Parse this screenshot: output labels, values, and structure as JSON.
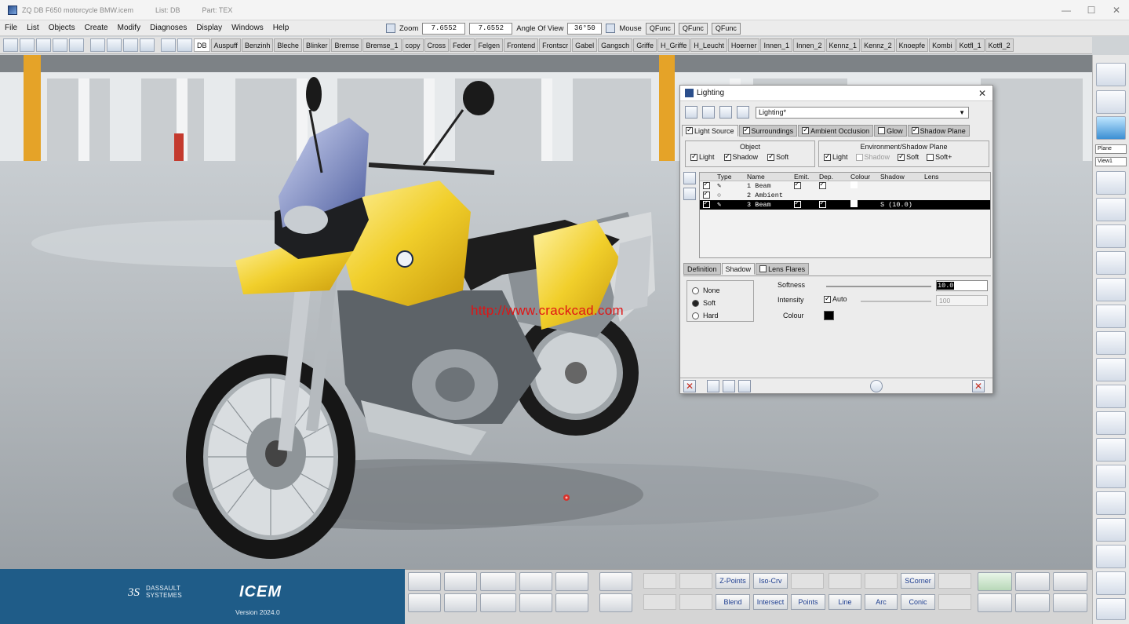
{
  "window": {
    "title_segments": [
      "ZQ DB F650 motorcycle BMW.icem",
      "List: DB",
      "Part: TEX"
    ]
  },
  "menu": [
    "File",
    "List",
    "Objects",
    "Create",
    "Modify",
    "Diagnoses",
    "Display",
    "Windows",
    "Help"
  ],
  "view_controls": {
    "zoom_label": "Zoom",
    "zoom_value_1": "7.6552",
    "zoom_value_2": "7.6552",
    "angle_label": "Angle Of View",
    "angle_value": "36°50",
    "mouse_label": "Mouse",
    "qfunc_buttons": [
      "QFunc",
      "QFunc",
      "QFunc"
    ]
  },
  "parts": [
    "DB",
    "Auspuff",
    "Benzinh",
    "Bleche",
    "Blinker",
    "Bremse",
    "Bremse_1",
    "copy",
    "Cross",
    "Feder",
    "Felgen",
    "Frontend",
    "Frontscr",
    "Gabel",
    "Gangsch",
    "Griffe",
    "H_Griffe",
    "H_Leucht",
    "Hoerner",
    "Innen_1",
    "Innen_2",
    "Kennz_1",
    "Kennz_2",
    "Knoepfe",
    "Kombi",
    "Kotfl_1",
    "Kotfl_2"
  ],
  "watermark": "http://www.crackcad.com",
  "lighting": {
    "title": "Lighting",
    "preset": "Lighting*",
    "tabs": [
      {
        "label": "Light Source",
        "checked": true
      },
      {
        "label": "Surroundings",
        "checked": true
      },
      {
        "label": "Ambient Occlusion",
        "checked": true
      },
      {
        "label": "Glow",
        "checked": false
      },
      {
        "label": "Shadow Plane",
        "checked": true
      }
    ],
    "object_group": {
      "title": "Object",
      "items": [
        {
          "label": "Light",
          "checked": true
        },
        {
          "label": "Shadow",
          "checked": true
        },
        {
          "label": "Soft",
          "checked": true
        }
      ]
    },
    "env_group": {
      "title": "Environment/Shadow Plane",
      "items": [
        {
          "label": "Light",
          "checked": true
        },
        {
          "label": "Shadow",
          "checked": false
        },
        {
          "label": "Soft",
          "checked": true
        },
        {
          "label": "Soft+",
          "checked": false
        }
      ]
    },
    "table": {
      "headers": [
        "Type",
        "Name",
        "Emit.",
        "Dep.",
        "Colour",
        "Shadow",
        "Lens"
      ],
      "rows": [
        {
          "num": "1",
          "name": "Beam",
          "emit": true,
          "dep": true,
          "shadow": "",
          "selected": false
        },
        {
          "num": "2",
          "name": "Ambient",
          "emit": false,
          "dep": false,
          "shadow": "",
          "selected": false
        },
        {
          "num": "3",
          "name": "Beam",
          "emit": true,
          "dep": true,
          "shadow": "S (10.0)",
          "selected": true
        }
      ]
    },
    "subtabs": [
      {
        "label": "Definition"
      },
      {
        "label": "Shadow"
      },
      {
        "label": "Lens Flares"
      }
    ],
    "shadow_modes": [
      "None",
      "Soft",
      "Hard"
    ],
    "softness_label": "Softness",
    "softness_value": "10.0",
    "intensity_label": "Intensity",
    "auto_label": "Auto",
    "intensity_value": "100",
    "colour_label": "Colour",
    "shadow_colour": "#000000"
  },
  "right_toolbar": {
    "select_1": "Plane",
    "select_2": "View1"
  },
  "brand": {
    "company": "DASSAULT SYSTEMES",
    "product": "ICEM",
    "version": "Version 2024.0"
  },
  "bottom_buttons": {
    "row1": [
      "Z-Points",
      "Iso-Crv",
      "SCorner"
    ],
    "row2": [
      "Blend",
      "Intersect",
      "Points",
      "Line",
      "Arc",
      "Conic"
    ]
  }
}
